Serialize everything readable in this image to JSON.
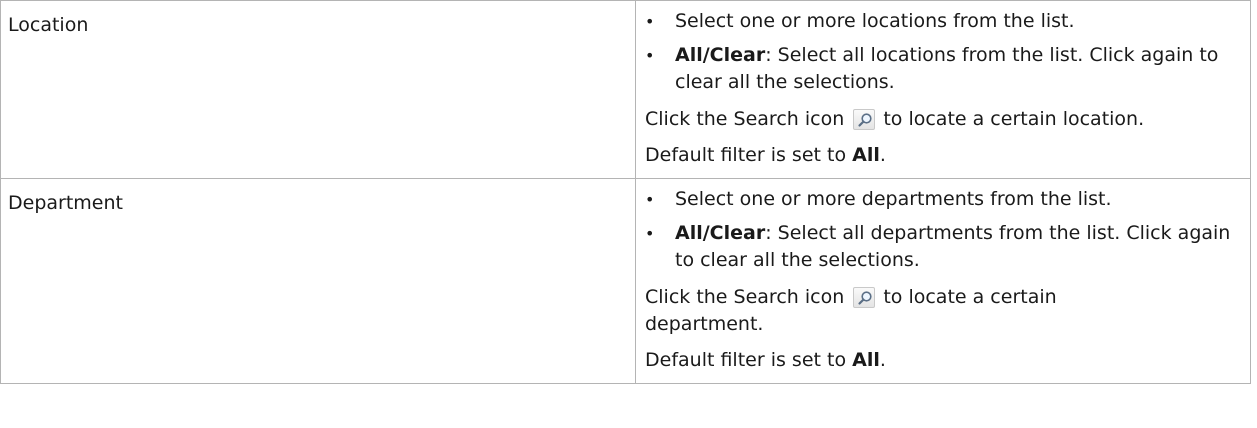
{
  "rows": [
    {
      "label": "Location",
      "bullets": [
        {
          "text": "Select one or more locations from the list."
        },
        {
          "bold": "All/Clear",
          "text": ": Select all locations from the list. Click again to clear all the selections."
        }
      ],
      "search_before": "Click the Search icon",
      "search_after": "to locate a certain location.",
      "default_before": "Default filter is set to ",
      "default_bold": "All",
      "default_after": "."
    },
    {
      "label": "Department",
      "bullets": [
        {
          "text": "Select one or more departments from the list."
        },
        {
          "bold": "All/Clear",
          "text": ": Select all departments from the list. Click again to clear all the selections."
        }
      ],
      "search_before": "Click the Search icon",
      "search_after": "to locate a certain department.",
      "default_before": "Default filter is set to ",
      "default_bold": "All",
      "default_after": "."
    }
  ],
  "bullet_glyph": "•",
  "icons": {
    "search": "magnifier-icon"
  }
}
